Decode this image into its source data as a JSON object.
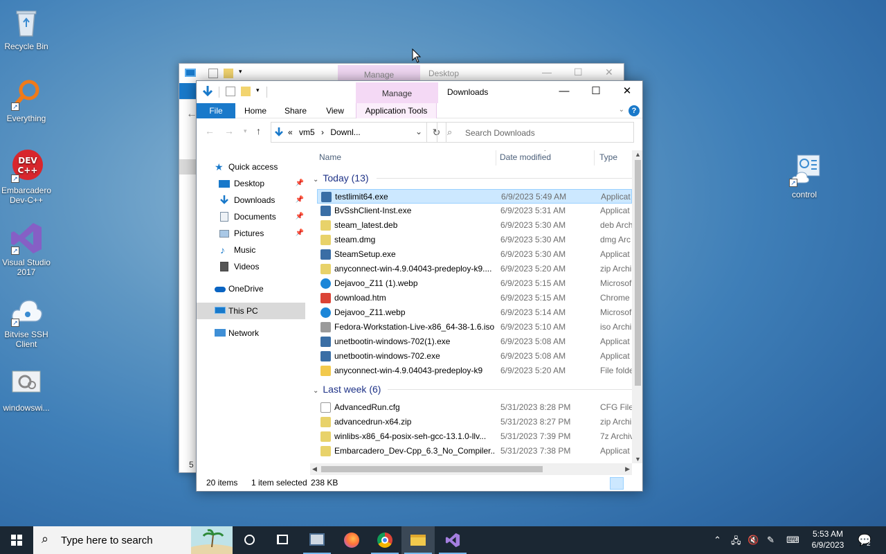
{
  "desktop": {
    "icons": [
      {
        "label": "Recycle Bin"
      },
      {
        "label": "Everything"
      },
      {
        "label": "Embarcadero Dev-C++"
      },
      {
        "label": "Visual Studio 2017"
      },
      {
        "label": "Bitvise SSH Client"
      },
      {
        "label": "windowswi..."
      },
      {
        "label": "control"
      }
    ]
  },
  "back_window": {
    "manage_label": "Manage",
    "title": "Desktop",
    "status_partial": "5 i"
  },
  "window": {
    "manage_label": "Manage",
    "title": "Downloads",
    "ribbon": {
      "file": "File",
      "home": "Home",
      "share": "Share",
      "view": "View",
      "app_tools": "Application Tools"
    },
    "address": {
      "chevrons": "«",
      "crumb1": "vm5",
      "sep": "›",
      "crumb2": "Downl..."
    },
    "search_placeholder": "Search Downloads",
    "sidebar": [
      {
        "label": "Quick access"
      },
      {
        "label": "Desktop"
      },
      {
        "label": "Downloads"
      },
      {
        "label": "Documents"
      },
      {
        "label": "Pictures"
      },
      {
        "label": "Music"
      },
      {
        "label": "Videos"
      },
      {
        "label": "OneDrive"
      },
      {
        "label": "This PC"
      },
      {
        "label": "Network"
      }
    ],
    "columns": {
      "name": "Name",
      "date": "Date modified",
      "type": "Type"
    },
    "groups": [
      {
        "header": "Today (13)"
      },
      {
        "header": "Last week (6)"
      }
    ],
    "today_files": [
      {
        "name": "testlimit64.exe",
        "date": "6/9/2023 5:49 AM",
        "type": "Applicat"
      },
      {
        "name": "BvSshClient-Inst.exe",
        "date": "6/9/2023 5:31 AM",
        "type": "Applicat"
      },
      {
        "name": "steam_latest.deb",
        "date": "6/9/2023 5:30 AM",
        "type": "deb Arch"
      },
      {
        "name": "steam.dmg",
        "date": "6/9/2023 5:30 AM",
        "type": "dmg Arc"
      },
      {
        "name": "SteamSetup.exe",
        "date": "6/9/2023 5:30 AM",
        "type": "Applicat"
      },
      {
        "name": "anyconnect-win-4.9.04043-predeploy-k9....",
        "date": "6/9/2023 5:20 AM",
        "type": "zip Archi"
      },
      {
        "name": "Dejavoo_Z11 (1).webp",
        "date": "6/9/2023 5:15 AM",
        "type": "Microsof"
      },
      {
        "name": "download.htm",
        "date": "6/9/2023 5:15 AM",
        "type": "Chrome"
      },
      {
        "name": "Dejavoo_Z11.webp",
        "date": "6/9/2023 5:14 AM",
        "type": "Microsof"
      },
      {
        "name": "Fedora-Workstation-Live-x86_64-38-1.6.iso",
        "date": "6/9/2023 5:10 AM",
        "type": "iso Archi"
      },
      {
        "name": "unetbootin-windows-702(1).exe",
        "date": "6/9/2023 5:08 AM",
        "type": "Applicat"
      },
      {
        "name": "unetbootin-windows-702.exe",
        "date": "6/9/2023 5:08 AM",
        "type": "Applicat"
      },
      {
        "name": "anyconnect-win-4.9.04043-predeploy-k9",
        "date": "6/9/2023 5:20 AM",
        "type": "File folde"
      }
    ],
    "lastweek_files": [
      {
        "name": "AdvancedRun.cfg",
        "date": "5/31/2023 8:28 PM",
        "type": "CFG File"
      },
      {
        "name": "advancedrun-x64.zip",
        "date": "5/31/2023 8:27 PM",
        "type": "zip Archi"
      },
      {
        "name": "winlibs-x86_64-posix-seh-gcc-13.1.0-llv...",
        "date": "5/31/2023 7:39 PM",
        "type": "7z Archiv"
      },
      {
        "name": "Embarcadero_Dev-Cpp_6.3_No_Compiler...",
        "date": "5/31/2023 7:38 PM",
        "type": "Applicat"
      }
    ],
    "status": {
      "items": "20 items",
      "selected": "1 item selected",
      "size": "238 KB"
    }
  },
  "taskbar": {
    "search_placeholder": "Type here to search",
    "time": "5:53 AM",
    "date": "6/9/2023",
    "notification_count": "2"
  },
  "colors": {
    "accent": "#1979ca",
    "manage_tab": "#f4d9f5",
    "selection": "#cce8ff",
    "taskbar": "#1b2733"
  }
}
